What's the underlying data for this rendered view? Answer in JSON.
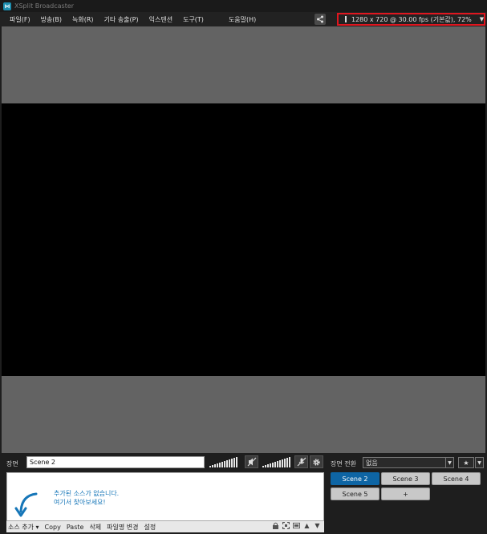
{
  "window": {
    "title": "XSplit Broadcaster",
    "icon": "xsplit-logo-icon"
  },
  "menu": {
    "items": [
      "파일(F)",
      "방송(B)",
      "녹화(R)",
      "기타 송출(P)",
      "익스텐션",
      "도구(T)"
    ],
    "help": "도움말(H)"
  },
  "resolution": {
    "label": "1280 x 720 @ 30.00 fps (기본값), 72%"
  },
  "scene": {
    "label": "장면",
    "name": "Scene 2"
  },
  "sources": {
    "empty_line1": "추가된 소스가 없습니다.",
    "empty_line2": "여기서 찾아보세요!"
  },
  "toolbar": {
    "add_source": "소스 추가 ▾",
    "copy": "Copy",
    "paste": "Paste",
    "delete": "삭제",
    "rename": "파일명 변경",
    "settings": "설정"
  },
  "transition": {
    "label": "장면 전환",
    "value": "없음"
  },
  "scenes": [
    "Scene 2",
    "Scene 3",
    "Scene 4",
    "Scene 5",
    "+"
  ],
  "active_scene": "Scene 2",
  "colors": {
    "accent": "#0e65a4",
    "highlight_box": "#e0161f",
    "stage": "#636363"
  }
}
